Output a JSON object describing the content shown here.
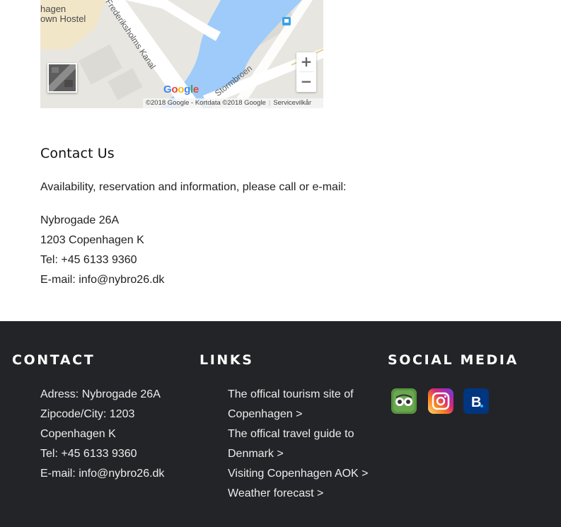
{
  "map": {
    "place_label_lines": [
      "hagen",
      "own Hostel"
    ],
    "canal_label": "Frederiksholms Kanal",
    "bridge_label": "Stormbroen",
    "zoom_in": "+",
    "zoom_out": "−",
    "logo_letters": [
      "G",
      "o",
      "o",
      "g",
      "l",
      "e"
    ],
    "logo_colors": [
      "#4285F4",
      "#EA4335",
      "#FBBC05",
      "#4285F4",
      "#34A853",
      "#EA4335"
    ],
    "attribution": "©2018 Google - Kortdata ©2018 Google",
    "terms": "Servicevilkår",
    "colors": {
      "water": "#9ecbf9",
      "land": "#e8e6e1",
      "park": "#f2e6c9",
      "road": "#ffffff",
      "transit": "#3ba2e6"
    }
  },
  "contact": {
    "title": "Contact Us",
    "intro": "Availability, reservation and information, please call or e-mail:",
    "address_lines": [
      "Nybrogade 26A",
      "1203 Copenhagen K",
      "Tel: +45 6133 9360",
      "E-mail: info@nybro26.dk"
    ]
  },
  "footer": {
    "background": "#232427",
    "contact": {
      "heading": "CONTACT",
      "lines": [
        "Adress: Nybrogade 26A",
        "Zipcode/City: 1203",
        "Copenhagen K",
        "Tel: +45 6133 9360",
        "E-mail: info@nybro26.dk"
      ]
    },
    "links": {
      "heading": "LINKS",
      "lines": [
        "The offical tourism site of",
        "Copenhagen >",
        "The offical travel guide to",
        "Denmark >",
        "Visiting Copenhagen AOK >",
        "Weather forecast >"
      ]
    },
    "social": {
      "heading": "SOCIAL MEDIA",
      "icons": [
        {
          "name": "tripadvisor-icon",
          "color": "#589442"
        },
        {
          "name": "instagram-icon",
          "color": "#c13584"
        },
        {
          "name": "booking-icon",
          "color": "#003580",
          "letter": "B"
        }
      ]
    }
  }
}
